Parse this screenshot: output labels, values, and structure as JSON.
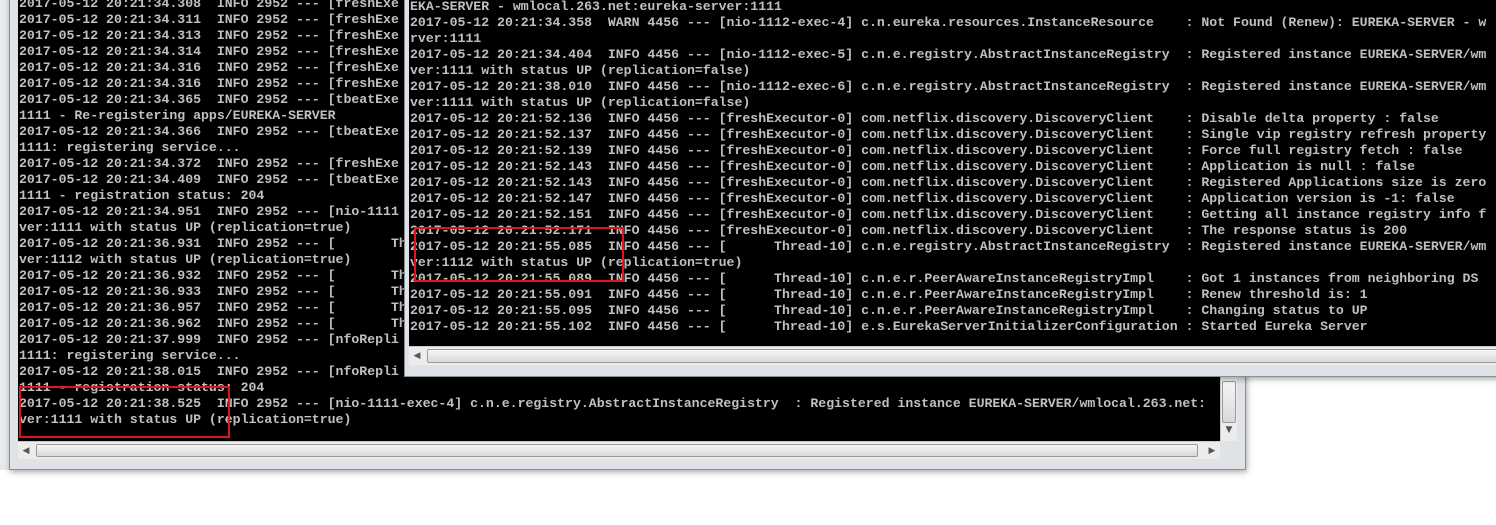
{
  "left_console": {
    "lines": [
      "2017-05-12 20:21:34.308  INFO 2952 --- [freshExe",
      "2017-05-12 20:21:34.311  INFO 2952 --- [freshExe",
      "2017-05-12 20:21:34.313  INFO 2952 --- [freshExe",
      "2017-05-12 20:21:34.314  INFO 2952 --- [freshExe",
      "2017-05-12 20:21:34.316  INFO 2952 --- [freshExe",
      "2017-05-12 20:21:34.316  INFO 2952 --- [freshExe",
      "2017-05-12 20:21:34.365  INFO 2952 --- [tbeatExe",
      "1111 - Re-registering apps/EUREKA-SERVER",
      "2017-05-12 20:21:34.366  INFO 2952 --- [tbeatExe",
      "1111: registering service...",
      "2017-05-12 20:21:34.372  INFO 2952 --- [freshExe",
      "2017-05-12 20:21:34.409  INFO 2952 --- [tbeatExe",
      "1111 - registration status: 204",
      "2017-05-12 20:21:34.951  INFO 2952 --- [nio-1111",
      "ver:1111 with status UP (replication=true)",
      "2017-05-12 20:21:36.931  INFO 2952 --- [       Th",
      "ver:1112 with status UP (replication=true)",
      "2017-05-12 20:21:36.932  INFO 2952 --- [       Th",
      "2017-05-12 20:21:36.933  INFO 2952 --- [       Th",
      "2017-05-12 20:21:36.957  INFO 2952 --- [       Th",
      "2017-05-12 20:21:36.962  INFO 2952 --- [       Th",
      "2017-05-12 20:21:37.999  INFO 2952 --- [nfoRepli",
      "1111: registering service...",
      "2017-05-12 20:21:38.015  INFO 2952 --- [nfoRepli",
      "1111 - registration status: 204",
      "2017-05-12 20:21:38.525  INFO 2952 --- [nio-1111-exec-4] c.n.e.registry.AbstractInstanceRegistry  : Registered instance EUREKA-SERVER/wmlocal.263.net:",
      "ver:1111 with status UP (replication=true)"
    ]
  },
  "right_console": {
    "lines": [
      "EKA-SERVER - wmlocal.263.net:eureka-server:1111",
      "2017-05-12 20:21:34.358  WARN 4456 --- [nio-1112-exec-4] c.n.eureka.resources.InstanceResource    : Not Found (Renew): EUREKA-SERVER - w",
      "rver:1111",
      "2017-05-12 20:21:34.404  INFO 4456 --- [nio-1112-exec-5] c.n.e.registry.AbstractInstanceRegistry  : Registered instance EUREKA-SERVER/wm",
      "ver:1111 with status UP (replication=false)",
      "2017-05-12 20:21:38.010  INFO 4456 --- [nio-1112-exec-6] c.n.e.registry.AbstractInstanceRegistry  : Registered instance EUREKA-SERVER/wm",
      "ver:1111 with status UP (replication=false)",
      "2017-05-12 20:21:52.136  INFO 4456 --- [freshExecutor-0] com.netflix.discovery.DiscoveryClient    : Disable delta property : false",
      "2017-05-12 20:21:52.137  INFO 4456 --- [freshExecutor-0] com.netflix.discovery.DiscoveryClient    : Single vip registry refresh property",
      "2017-05-12 20:21:52.139  INFO 4456 --- [freshExecutor-0] com.netflix.discovery.DiscoveryClient    : Force full registry fetch : false",
      "2017-05-12 20:21:52.143  INFO 4456 --- [freshExecutor-0] com.netflix.discovery.DiscoveryClient    : Application is null : false",
      "2017-05-12 20:21:52.143  INFO 4456 --- [freshExecutor-0] com.netflix.discovery.DiscoveryClient    : Registered Applications size is zero",
      "2017-05-12 20:21:52.147  INFO 4456 --- [freshExecutor-0] com.netflix.discovery.DiscoveryClient    : Application version is -1: false",
      "2017-05-12 20:21:52.151  INFO 4456 --- [freshExecutor-0] com.netflix.discovery.DiscoveryClient    : Getting all instance registry info f",
      "2017-05-12 20:21:52.171  INFO 4456 --- [freshExecutor-0] com.netflix.discovery.DiscoveryClient    : The response status is 200",
      "2017-05-12 20:21:55.085  INFO 4456 --- [      Thread-10] c.n.e.registry.AbstractInstanceRegistry  : Registered instance EUREKA-SERVER/wm",
      "ver:1112 with status UP (replication=true)",
      "2017-05-12 20:21:55.089  INFO 4456 --- [      Thread-10] c.n.e.r.PeerAwareInstanceRegistryImpl    : Got 1 instances from neighboring DS",
      "2017-05-12 20:21:55.091  INFO 4456 --- [      Thread-10] c.n.e.r.PeerAwareInstanceRegistryImpl    : Renew threshold is: 1",
      "2017-05-12 20:21:55.095  INFO 4456 --- [      Thread-10] c.n.e.r.PeerAwareInstanceRegistryImpl    : Changing status to UP",
      "2017-05-12 20:21:55.102  INFO 4456 --- [      Thread-10] e.s.EurekaServerInitializerConfiguration : Started Eureka Server"
    ]
  },
  "colors": {
    "console_bg": "#000000",
    "console_text": "#c0c0c0",
    "highlight_box": "#e0141e"
  },
  "icons": {
    "scroll_left": "arrow-left-icon",
    "scroll_right": "arrow-right-icon",
    "scroll_up": "arrow-up-icon",
    "scroll_down": "arrow-down-icon"
  }
}
